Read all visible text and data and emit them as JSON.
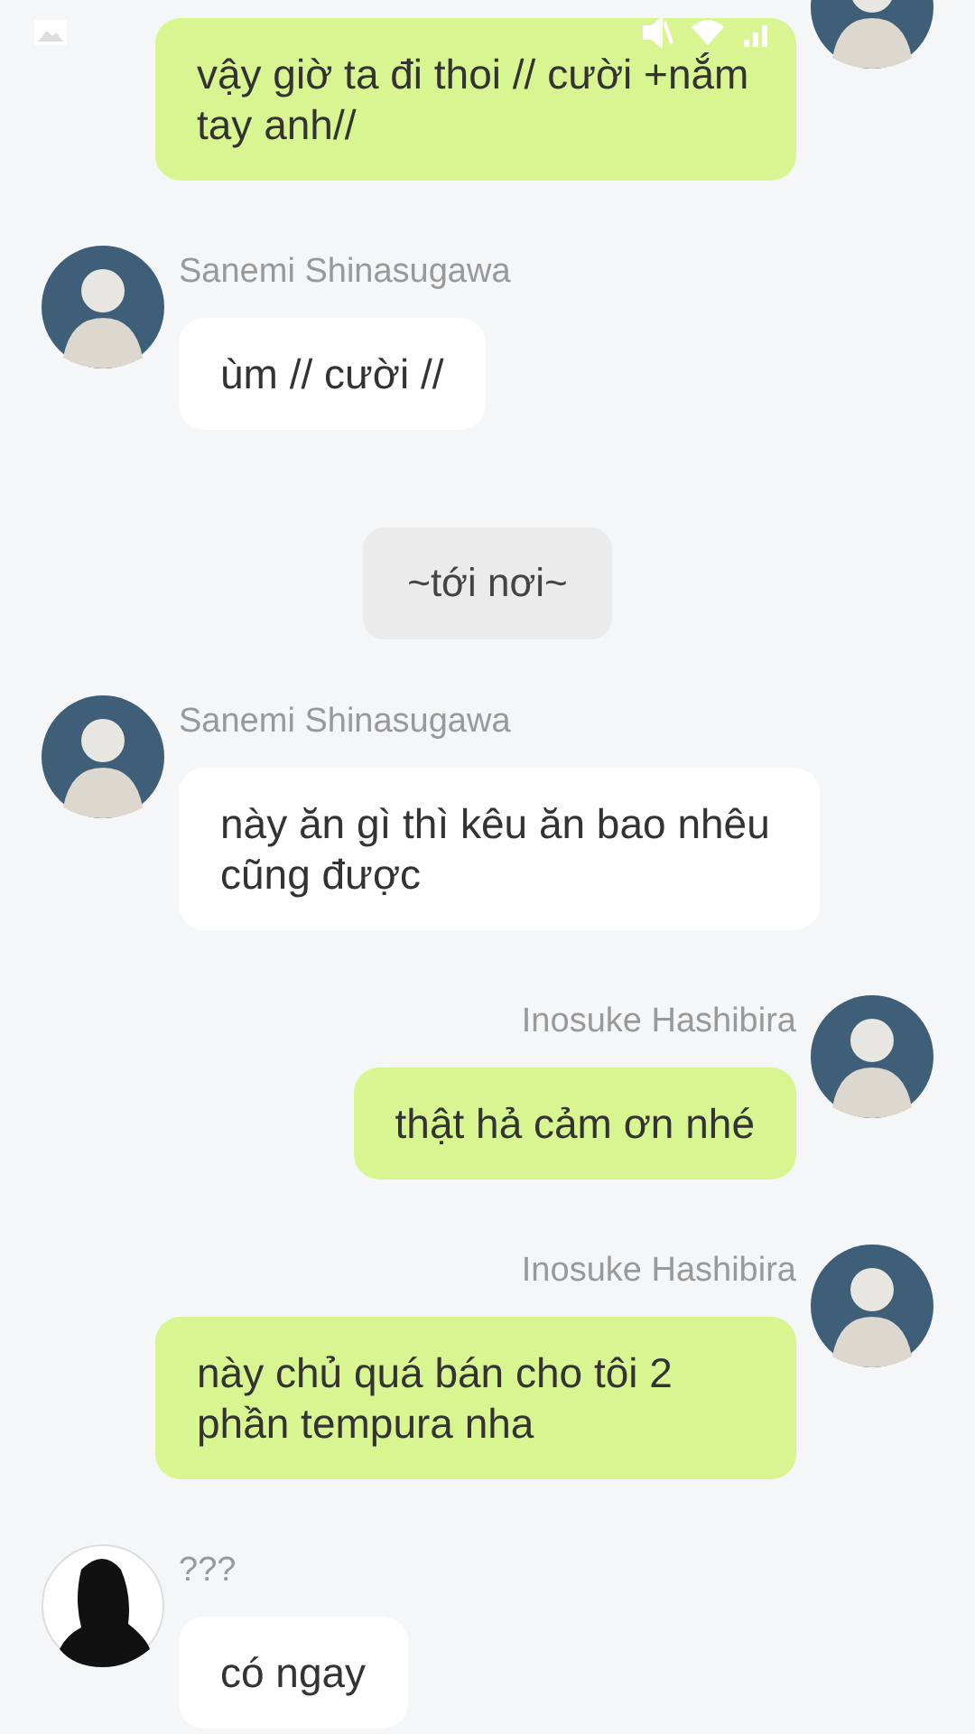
{
  "status_bar": {
    "icons": [
      {
        "kind": "gallery"
      },
      {
        "kind": "mute"
      },
      {
        "kind": "wifi"
      },
      {
        "kind": "signal"
      }
    ]
  },
  "messages": [
    {
      "kind": "outgoing",
      "avatar": {
        "kind": "photo"
      },
      "text": "vậy giờ ta đi thoi // cười +nắm tay anh//"
    },
    {
      "kind": "incoming",
      "avatar": {
        "kind": "photo"
      },
      "name": "Sanemi Shinasugawa",
      "text": "ùm // cười //"
    },
    {
      "kind": "system",
      "text": "~tới nơi~"
    },
    {
      "kind": "incoming",
      "avatar": {
        "kind": "photo"
      },
      "name": "Sanemi Shinasugawa",
      "text": "này ăn gì thì kêu ăn bao nhêu cũng được"
    },
    {
      "kind": "outgoing",
      "avatar": {
        "kind": "photo"
      },
      "name": "Inosuke Hashibira",
      "text": "thật hả cảm ơn nhé"
    },
    {
      "kind": "outgoing",
      "avatar": {
        "kind": "photo"
      },
      "name": "Inosuke Hashibira",
      "text": "này chủ quá bán cho tôi 2 phần tempura nha"
    },
    {
      "kind": "incoming",
      "avatar": {
        "kind": "silhouette"
      },
      "name": "???",
      "text": "có ngay"
    }
  ]
}
